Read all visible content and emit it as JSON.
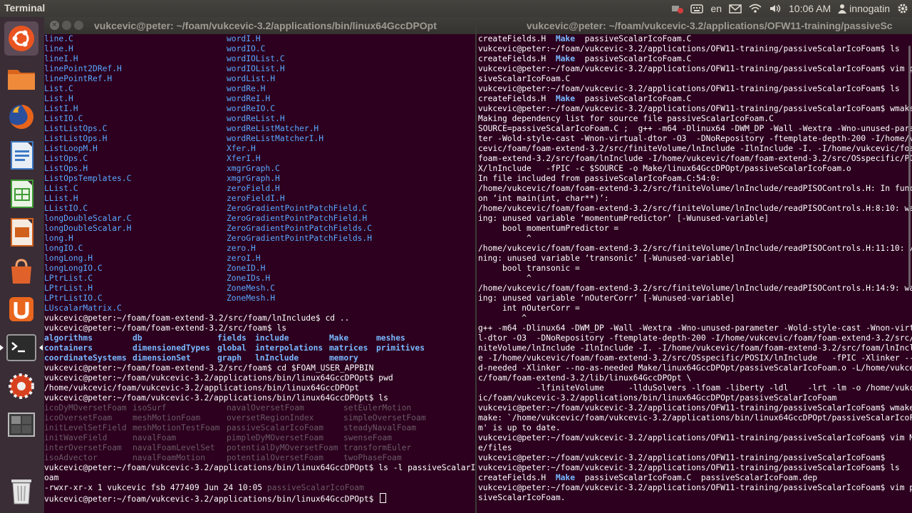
{
  "panel": {
    "app_title": "Terminal",
    "keyboard_layout": "en",
    "clock": "10:06 AM",
    "user": "innogatin",
    "icons": [
      "record-icon",
      "keyboard-icon",
      "mail-icon",
      "network-icon",
      "volume-icon",
      "gear-icon"
    ]
  },
  "launcher": {
    "items": [
      "ubuntu-dash",
      "files",
      "firefox",
      "libreoffice-writer",
      "libreoffice-calc",
      "libreoffice-impress",
      "software-center",
      "ubuntu-one",
      "terminal",
      "system-settings",
      "workspace-switcher",
      "trash"
    ]
  },
  "left_terminal": {
    "title": "vukcevic@peter: ~/foam/vukcevic-3.2/applications/bin/linux64GccDPOpt",
    "two_col": [
      [
        "line.C",
        "wordI.H"
      ],
      [
        "line.H",
        "wordIO.C"
      ],
      [
        "lineI.H",
        "wordIOList.C"
      ],
      [
        "linePoint2DRef.H",
        "wordIOList.H"
      ],
      [
        "linePointRef.H",
        "wordList.H"
      ],
      [
        "List.C",
        "wordRe.H"
      ],
      [
        "List.H",
        "wordReI.H"
      ],
      [
        "ListI.H",
        "wordReIO.C"
      ],
      [
        "ListIO.C",
        "wordReList.H"
      ],
      [
        "ListListOps.C",
        "wordReListMatcher.H"
      ],
      [
        "ListListOps.H",
        "wordReListMatcherI.H"
      ],
      [
        "ListLoopM.H",
        "Xfer.H"
      ],
      [
        "ListOps.C",
        "XferI.H"
      ],
      [
        "ListOps.H",
        "xmgrGraph.C"
      ],
      [
        "ListOpsTemplates.C",
        "xmgrGraph.H"
      ],
      [
        "LList.C",
        "zeroField.H"
      ],
      [
        "LList.H",
        "zeroFieldI.H"
      ],
      [
        "LListIO.C",
        "ZeroGradientPointPatchField.C"
      ],
      [
        "longDoubleScalar.C",
        "ZeroGradientPointPatchField.H"
      ],
      [
        "longDoubleScalar.H",
        "ZeroGradientPointPatchFields.C"
      ],
      [
        "long.H",
        "ZeroGradientPointPatchFields.H"
      ],
      [
        "longIO.C",
        "zero.H"
      ],
      [
        "longLong.H",
        "zeroI.H"
      ],
      [
        "longLongIO.C",
        "ZoneID.H"
      ],
      [
        "LPtrList.C",
        "ZoneIDs.H"
      ],
      [
        "LPtrList.H",
        "ZoneMesh.C"
      ],
      [
        "LPtrListIO.C",
        "ZoneMesh.H"
      ]
    ],
    "last_file": "LUscalarMatrix.C",
    "cmd1": "vukcevic@peter:~/foam/foam-extend-3.2/src/foam/lnInclude$ cd ..",
    "cmd2": "vukcevic@peter:~/foam/foam-extend-3.2/src/foam$ ls",
    "dirs": [
      [
        "algorithms",
        "db",
        "fields",
        "include",
        "Make",
        "meshes"
      ],
      [
        "containers",
        "dimensionedTypes",
        "global",
        "interpolations",
        "matrices",
        "primitives"
      ],
      [
        "coordinateSystems",
        "dimensionSet",
        "graph",
        "lnInclude",
        "memory",
        ""
      ]
    ],
    "cmd3": "vukcevic@peter:~/foam/foam-extend-3.2/src/foam$ cd $FOAM_USER_APPBIN",
    "cmd4": "vukcevic@peter:~/foam/vukcevic-3.2/applications/bin/linux64GccDPOpt$ pwd",
    "pwd_out": "/home/vukcevic/foam/vukcevic-3.2/applications/bin/linux64GccDPOpt",
    "cmd5": "vukcevic@peter:~/foam/vukcevic-3.2/applications/bin/linux64GccDPOpt$ ls",
    "bins": [
      [
        "icoDyMOversetFoam",
        "isoSurf",
        "navalOversetFoam",
        "setEulerMotion"
      ],
      [
        "icoOversetFoam",
        "meshMotionFoam",
        "oversetRegionIndex",
        "simpleOversetFoam"
      ],
      [
        "initLevelSetField",
        "meshMotionTestFoam",
        "passiveScalarIcoFoam",
        "steadyNavalFoam"
      ],
      [
        "initWaveField",
        "navalFoam",
        "pimpleDyMOversetFoam",
        "swenseFoam"
      ],
      [
        "interOversetFoam",
        "navalFoamLevelSet",
        "potentialDyMOversetFoam",
        "transformEuler"
      ],
      [
        "isoAdvector",
        "navalFoamMotion",
        "potentialOversetFoam",
        "twoPhaseFoam"
      ]
    ],
    "cmd6a": "vukcevic@peter:~/foam/vukcevic-3.2/applications/bin/linux64GccDPOpt$ ls -l passiveScalarIcoF",
    "cmd6b": "oam",
    "ls_l_prefix": "-rwxr-xr-x 1 vukcevic fsb 477409 Jun 24 10:05 ",
    "ls_l_name": "passiveScalarIcoFoam",
    "prompt_final": "vukcevic@peter:~/foam/vukcevic-3.2/applications/bin/linux64GccDPOpt$ "
  },
  "right_terminal": {
    "title": "vukcevic@peter: ~/foam/vukcevic-3.2/applications/OFW11-training/passiveSc",
    "lines": [
      [
        {
          "t": "createFields.H  "
        },
        {
          "t": "Make",
          "c": "dir"
        },
        {
          "t": "  passiveScalarIcoFoam.C"
        }
      ],
      [
        {
          "t": "vukcevic@peter:~/foam/vukcevic-3.2/applications/OFW11-training/passiveScalarIcoFoam$ ls"
        }
      ],
      [
        {
          "t": "createFields.H  "
        },
        {
          "t": "Make",
          "c": "dir"
        },
        {
          "t": "  passiveScalarIcoFoam.C"
        }
      ],
      [
        {
          "t": "vukcevic@peter:~/foam/vukcevic-3.2/applications/OFW11-training/passiveScalarIcoFoam$ vim pas"
        }
      ],
      [
        {
          "t": "siveScalarIcoFoam.C"
        }
      ],
      [
        {
          "t": "vukcevic@peter:~/foam/vukcevic-3.2/applications/OFW11-training/passiveScalarIcoFoam$ ls"
        }
      ],
      [
        {
          "t": "createFields.H  "
        },
        {
          "t": "Make",
          "c": "dir"
        },
        {
          "t": "  passiveScalarIcoFoam.C"
        }
      ],
      [
        {
          "t": "vukcevic@peter:~/foam/vukcevic-3.2/applications/OFW11-training/passiveScalarIcoFoam$ wmake"
        }
      ],
      [
        {
          "t": "Making dependency list for source file passiveScalarIcoFoam.C"
        }
      ],
      [
        {
          "t": "SOURCE=passiveScalarIcoFoam.C ;  g++ -m64 -Dlinux64 -DWM_DP -Wall -Wextra -Wno-unused-parame"
        }
      ],
      [
        {
          "t": "ter -Wold-style-cast -Wnon-virtual-dtor -O3  -DNoRepository -ftemplate-depth-200 -I/home/vuk"
        }
      ],
      [
        {
          "t": "cevic/foam/foam-extend-3.2/src/finiteVolume/lnInclude -IlnInclude -I. -I/home/vukcevic/foam/"
        }
      ],
      [
        {
          "t": "foam-extend-3.2/src/foam/lnInclude -I/home/vukcevic/foam/foam-extend-3.2/src/OSspecific/POSI"
        }
      ],
      [
        {
          "t": "X/lnInclude   -fPIC -c $SOURCE -o Make/linux64GccDPOpt/passiveScalarIcoFoam.o"
        }
      ],
      [
        {
          "t": "In file included from passiveScalarIcoFoam.C:54:0:"
        }
      ],
      [
        {
          "t": "/home/vukcevic/foam/foam-extend-3.2/src/finiteVolume/lnInclude/readPISOControls.H: In functi"
        }
      ],
      [
        {
          "t": "on ‘int main(int, char**)’:"
        }
      ],
      [
        {
          "t": "/home/vukcevic/foam/foam-extend-3.2/src/finiteVolume/lnInclude/readPISOControls.H:8:10: warn"
        }
      ],
      [
        {
          "t": "ing: unused variable ‘momentumPredictor’ [-Wunused-variable]"
        }
      ],
      [
        {
          "t": "     bool momentumPredictor ="
        }
      ],
      [
        {
          "t": "          ^"
        }
      ],
      [
        {
          "t": "/home/vukcevic/foam/foam-extend-3.2/src/finiteVolume/lnInclude/readPISOControls.H:11:10: war"
        }
      ],
      [
        {
          "t": "ning: unused variable ‘transonic’ [-Wunused-variable]"
        }
      ],
      [
        {
          "t": "     bool transonic ="
        }
      ],
      [
        {
          "t": "          ^"
        }
      ],
      [
        {
          "t": "/home/vukcevic/foam/foam-extend-3.2/src/finiteVolume/lnInclude/readPISOControls.H:14:9: warn"
        }
      ],
      [
        {
          "t": "ing: unused variable ‘nOuterCorr’ [-Wunused-variable]"
        }
      ],
      [
        {
          "t": "     int nOuterCorr ="
        }
      ],
      [
        {
          "t": "         ^"
        }
      ],
      [
        {
          "t": "g++ -m64 -Dlinux64 -DWM_DP -Wall -Wextra -Wno-unused-parameter -Wold-style-cast -Wnon-virtua"
        }
      ],
      [
        {
          "t": "l-dtor -O3  -DNoRepository -ftemplate-depth-200 -I/home/vukcevic/foam/foam-extend-3.2/src/fi"
        }
      ],
      [
        {
          "t": "niteVolume/lnInclude -IlnInclude -I. -I/home/vukcevic/foam/foam-extend-3.2/src/foam/lnInclud"
        }
      ],
      [
        {
          "t": "e -I/home/vukcevic/foam/foam-extend-3.2/src/OSspecific/POSIX/lnInclude   -fPIC -Xlinker --ad"
        }
      ],
      [
        {
          "t": "d-needed -Xlinker --no-as-needed Make/linux64GccDPOpt/passiveScalarIcoFoam.o -L/home/vukcevi"
        }
      ],
      [
        {
          "t": "c/foam/foam-extend-3.2/lib/linux64GccDPOpt \\"
        }
      ],
      [
        {
          "t": "            -lfiniteVolume     -llduSolvers -lfoam -liberty -ldl    -lrt -lm -o /home/vukcev"
        }
      ],
      [
        {
          "t": "ic/foam/vukcevic-3.2/applications/bin/linux64GccDPOpt/passiveScalarIcoFoam"
        }
      ],
      [
        {
          "t": "vukcevic@peter:~/foam/vukcevic-3.2/applications/OFW11-training/passiveScalarIcoFoam$ wmake"
        }
      ],
      [
        {
          "t": "make: `/home/vukcevic/foam/vukcevic-3.2/applications/bin/linux64GccDPOpt/passiveScalarIcoFoa"
        }
      ],
      [
        {
          "t": "m' is up to date."
        }
      ],
      [
        {
          "t": "vukcevic@peter:~/foam/vukcevic-3.2/applications/OFW11-training/passiveScalarIcoFoam$ vim Make"
        }
      ],
      [
        {
          "t": "e/files"
        }
      ],
      [
        {
          "t": "vukcevic@peter:~/foam/vukcevic-3.2/applications/OFW11-training/passiveScalarIcoFoam$"
        }
      ],
      [
        {
          "t": "vukcevic@peter:~/foam/vukcevic-3.2/applications/OFW11-training/passiveScalarIcoFoam$ ls"
        }
      ],
      [
        {
          "t": "createFields.H  "
        },
        {
          "t": "Make",
          "c": "dir"
        },
        {
          "t": "  passiveScalarIcoFoam.C  passiveScalarIcoFoam.dep"
        }
      ],
      [
        {
          "t": "vukcevic@peter:~/foam/vukcevic-3.2/applications/OFW11-training/passiveScalarIcoFoam$ vim pas"
        }
      ],
      [
        {
          "t": "siveScalarIcoFoam."
        }
      ]
    ]
  },
  "colors": {
    "terminal_bg": "#2c001e",
    "panel_bg": "#3b3a36",
    "file_blue": "#59a8ff",
    "dir_blue": "#79b8ff",
    "dim_text": "#6b5a66"
  }
}
